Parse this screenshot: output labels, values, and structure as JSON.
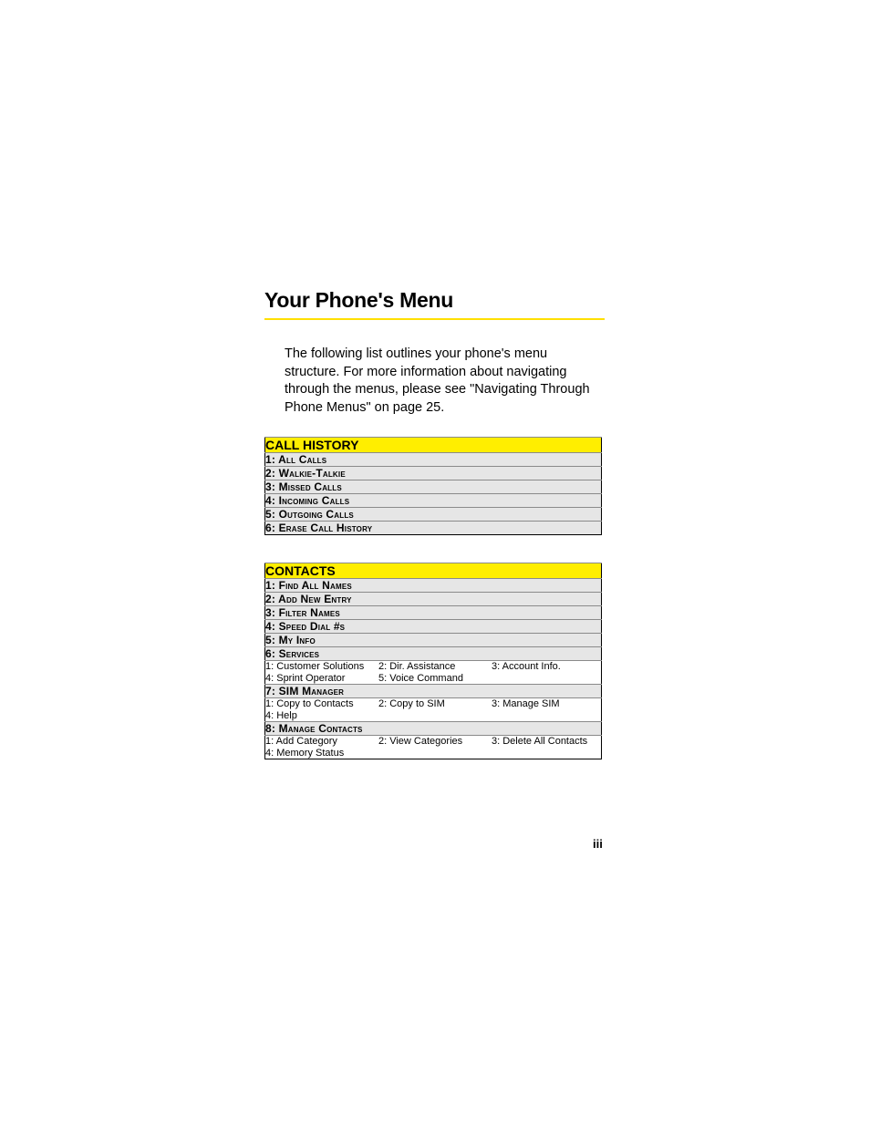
{
  "heading": "Your Phone's Menu",
  "intro": "The following list outlines your phone's menu structure. For more information about navigating through the menus, please see \"Navigating Through Phone Menus\" on page 25.",
  "page_number": "iii",
  "sections": [
    {
      "title": "CALL HISTORY",
      "items": [
        {
          "label": "1: All Calls"
        },
        {
          "label": "2: Walkie-Talkie"
        },
        {
          "label": "3: Missed Calls"
        },
        {
          "label": "4: Incoming Calls"
        },
        {
          "label": "5: Outgoing Calls"
        },
        {
          "label": "6: Erase Call History"
        }
      ]
    },
    {
      "title": "CONTACTS",
      "items": [
        {
          "label": "1: Find All Names"
        },
        {
          "label": "2: Add New Entry"
        },
        {
          "label": "3: Filter Names"
        },
        {
          "label": "4: Speed Dial #s"
        },
        {
          "label": "5: My Info"
        },
        {
          "label": "6: Services",
          "sub": [
            "1: Customer Solutions",
            "2: Dir. Assistance",
            "3: Account Info.",
            "4: Sprint Operator",
            "5: Voice Command",
            ""
          ]
        },
        {
          "label": "7: SIM Manager",
          "sub": [
            "1: Copy to Contacts",
            "2: Copy to SIM",
            "3: Manage SIM",
            "4: Help",
            "",
            ""
          ]
        },
        {
          "label": "8: Manage Contacts",
          "sub": [
            "1: Add Category",
            "2: View Categories",
            "3: Delete All Contacts",
            "4: Memory Status",
            "",
            ""
          ]
        }
      ]
    }
  ]
}
